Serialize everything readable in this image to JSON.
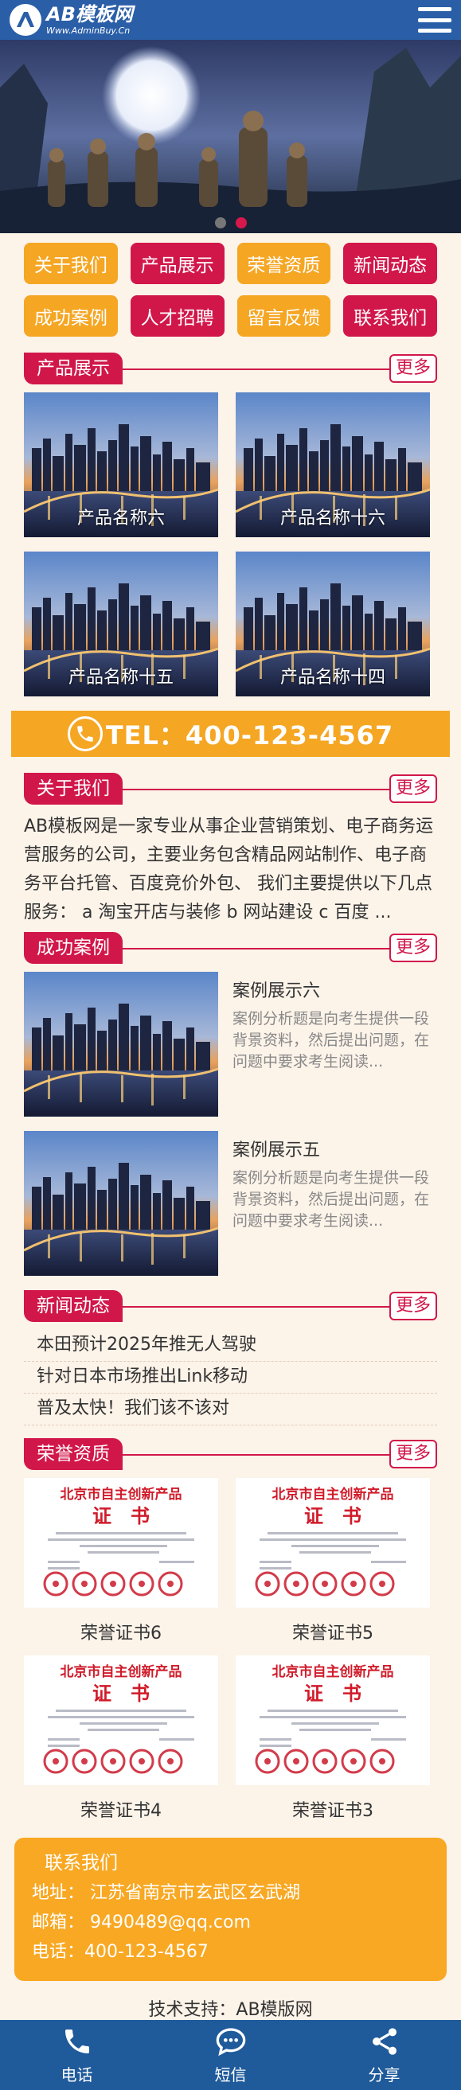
{
  "header": {
    "logo_main": "AB模板网",
    "logo_sub": "Www.AdminBuy.Cn"
  },
  "banner": {
    "active_slide": 2,
    "slide_count": 2
  },
  "nav": [
    {
      "label": "关于我们",
      "color": "orange"
    },
    {
      "label": "产品展示",
      "color": "red"
    },
    {
      "label": "荣誉资质",
      "color": "orange"
    },
    {
      "label": "新闻动态",
      "color": "red"
    },
    {
      "label": "成功案例",
      "color": "orange"
    },
    {
      "label": "人才招聘",
      "color": "red"
    },
    {
      "label": "留言反馈",
      "color": "orange"
    },
    {
      "label": "联系我们",
      "color": "red"
    }
  ],
  "more_label": "更多",
  "products": {
    "title": "产品展示",
    "items": [
      "产品名称六",
      "产品名称十六",
      "产品名称十五",
      "产品名称十四"
    ]
  },
  "tel": {
    "label": "TEL：400-123-4567"
  },
  "about": {
    "title": "关于我们",
    "text": "AB模板网是一家专业从事企业营销策划、电子商务运营服务的公司，主要业务包含精品网站制作、电子商务平台托管、百度竞价外包、 我们主要提供以下几点服务： a 淘宝开店与装修 b 网站建设 c 百度 ..."
  },
  "cases": {
    "title": "成功案例",
    "items": [
      {
        "title": "案例展示六",
        "desc": "案例分析题是向考生提供一段背景资料，然后提出问题，在问题中要求考生阅读..."
      },
      {
        "title": "案例展示五",
        "desc": "案例分析题是向考生提供一段背景资料，然后提出问题，在问题中要求考生阅读..."
      }
    ]
  },
  "news": {
    "title": "新闻动态",
    "items": [
      "本田预计2025年推无人驾驶",
      "针对日本市场推出Link移动",
      "普及太快！我们该不该对"
    ]
  },
  "honors": {
    "title": "荣誉资质",
    "cert_heading": "北京市自主创新产品",
    "cert_title": "证　书",
    "items": [
      "荣誉证书6",
      "荣誉证书5",
      "荣誉证书4",
      "荣誉证书3"
    ]
  },
  "contact": {
    "title": "联系我们",
    "address": "地址：  江苏省南京市玄武区玄武湖",
    "email": "邮箱：  9490489@qq.com",
    "phone": "电话：400-123-4567"
  },
  "support": "技术支持：AB模版网",
  "footer": [
    {
      "label": "电话",
      "icon": "phone-icon"
    },
    {
      "label": "短信",
      "icon": "message-icon"
    },
    {
      "label": "分享",
      "icon": "share-icon"
    }
  ],
  "colors": {
    "header": "#2a5fa8",
    "accent_red": "#d1174a",
    "accent_orange": "#f5a623",
    "footer": "#1f5a9a",
    "background": "#fcf3e9"
  }
}
